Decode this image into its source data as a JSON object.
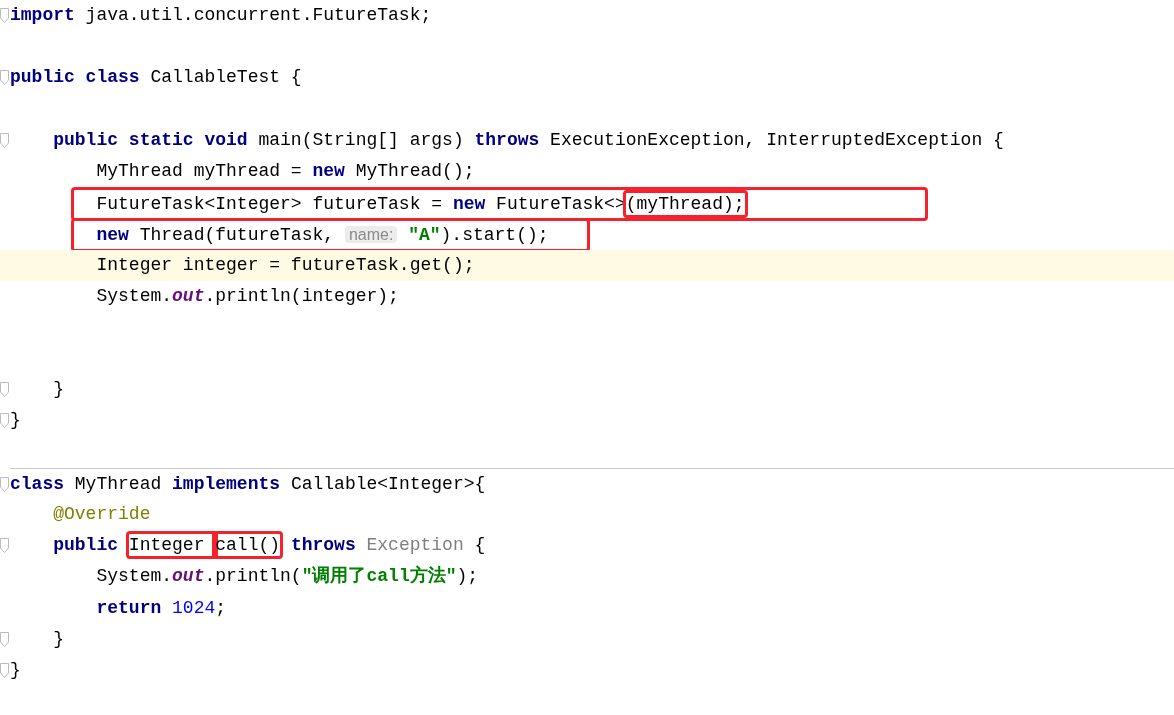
{
  "editor": {
    "lines": [
      {
        "kind": "code",
        "fold": true,
        "current": false,
        "boxed": false,
        "separator": false,
        "tokens": [
          {
            "text": "import",
            "kind": "kw"
          },
          {
            "text": " java.util.concurrent.FutureTask;",
            "kind": "plain"
          }
        ]
      },
      {
        "kind": "blank",
        "current": false
      },
      {
        "kind": "code",
        "fold": true,
        "current": false,
        "boxed": false,
        "separator": false,
        "tokens": [
          {
            "text": "public class",
            "kind": "kw"
          },
          {
            "text": " CallableTest {",
            "kind": "plain"
          }
        ]
      },
      {
        "kind": "blank",
        "current": false
      },
      {
        "kind": "code",
        "fold": true,
        "current": false,
        "boxed": false,
        "separator": false,
        "tokens": [
          {
            "text": "    public static void",
            "kind": "kw"
          },
          {
            "text": " main(String[] args) ",
            "kind": "plain"
          },
          {
            "text": "throws",
            "kind": "kw"
          },
          {
            "text": " ExecutionException, InterruptedException {",
            "kind": "plain"
          }
        ]
      },
      {
        "kind": "code",
        "fold": false,
        "current": false,
        "boxed": false,
        "separator": false,
        "tokens": [
          {
            "text": "        MyThread myThread = ",
            "kind": "plain"
          },
          {
            "text": "new",
            "kind": "kw"
          },
          {
            "text": " MyThread();",
            "kind": "plain"
          }
        ]
      },
      {
        "kind": "code",
        "fold": false,
        "current": false,
        "boxed": true,
        "separator": false,
        "tokens": [
          {
            "text": "        FutureTask<Integer> futureTask = ",
            "kind": "plain"
          },
          {
            "text": "new",
            "kind": "kw"
          },
          {
            "text": " FutureTask<>",
            "kind": "plain"
          },
          {
            "text": "(myThread);",
            "kind": "plain",
            "boxed": true
          }
        ]
      },
      {
        "kind": "code",
        "fold": false,
        "current": false,
        "boxed": true,
        "separator": false,
        "tokens": [
          {
            "text": "        new",
            "kind": "kw"
          },
          {
            "text": " Thread(futureTask, ",
            "kind": "plain"
          },
          {
            "text": "name:",
            "kind": "hint"
          },
          {
            "text": " \"A\"",
            "kind": "str"
          },
          {
            "text": ").start();",
            "kind": "plain"
          }
        ]
      },
      {
        "kind": "code",
        "fold": false,
        "current": true,
        "boxed": false,
        "separator": false,
        "tokens": [
          {
            "text": "        Integer integer = futureTask.get();",
            "kind": "plain"
          }
        ]
      },
      {
        "kind": "code",
        "fold": false,
        "current": false,
        "boxed": false,
        "separator": false,
        "tokens": [
          {
            "text": "        System.",
            "kind": "plain"
          },
          {
            "text": "out",
            "kind": "field"
          },
          {
            "text": ".println(integer);",
            "kind": "plain"
          }
        ]
      },
      {
        "kind": "blank",
        "current": false
      },
      {
        "kind": "blank",
        "current": false
      },
      {
        "kind": "code",
        "fold": true,
        "current": false,
        "boxed": false,
        "separator": false,
        "tokens": [
          {
            "text": "    }",
            "kind": "plain"
          }
        ]
      },
      {
        "kind": "code",
        "fold": true,
        "current": false,
        "boxed": false,
        "separator": false,
        "tokens": [
          {
            "text": "}",
            "kind": "plain"
          }
        ]
      },
      {
        "kind": "blank",
        "current": false
      },
      {
        "kind": "code",
        "fold": true,
        "current": false,
        "boxed": false,
        "separator": true,
        "tokens": [
          {
            "text": "class",
            "kind": "kw"
          },
          {
            "text": " MyThread ",
            "kind": "plain"
          },
          {
            "text": "implements",
            "kind": "kw"
          },
          {
            "text": " Callable<Integer>{",
            "kind": "plain"
          }
        ]
      },
      {
        "kind": "code",
        "fold": false,
        "current": false,
        "boxed": false,
        "separator": false,
        "tokens": [
          {
            "text": "    @Override",
            "kind": "annot"
          }
        ]
      },
      {
        "kind": "code",
        "fold": true,
        "current": false,
        "boxed": false,
        "separator": false,
        "tokens": [
          {
            "text": "    public ",
            "kind": "kw"
          },
          {
            "text": "Integer ",
            "kind": "plain",
            "boxed": true
          },
          {
            "text": "call()",
            "kind": "plain",
            "boxed": true
          },
          {
            "text": " throws ",
            "kind": "kw"
          },
          {
            "text": "Exception",
            "kind": "muted"
          },
          {
            "text": " {",
            "kind": "plain"
          }
        ]
      },
      {
        "kind": "code",
        "fold": false,
        "current": false,
        "boxed": false,
        "separator": false,
        "tokens": [
          {
            "text": "        System.",
            "kind": "plain"
          },
          {
            "text": "out",
            "kind": "field"
          },
          {
            "text": ".println(",
            "kind": "plain"
          },
          {
            "text": "\"调用了call方法\"",
            "kind": "str"
          },
          {
            "text": ");",
            "kind": "plain"
          }
        ]
      },
      {
        "kind": "code",
        "fold": false,
        "current": false,
        "boxed": false,
        "separator": false,
        "tokens": [
          {
            "text": "        return ",
            "kind": "kw"
          },
          {
            "text": "1024",
            "kind": "num"
          },
          {
            "text": ";",
            "kind": "plain"
          }
        ]
      },
      {
        "kind": "code",
        "fold": true,
        "current": false,
        "boxed": false,
        "separator": false,
        "tokens": [
          {
            "text": "    }",
            "kind": "plain"
          }
        ]
      },
      {
        "kind": "code",
        "fold": true,
        "current": false,
        "boxed": false,
        "separator": false,
        "tokens": [
          {
            "text": "}",
            "kind": "plain"
          }
        ]
      }
    ]
  }
}
